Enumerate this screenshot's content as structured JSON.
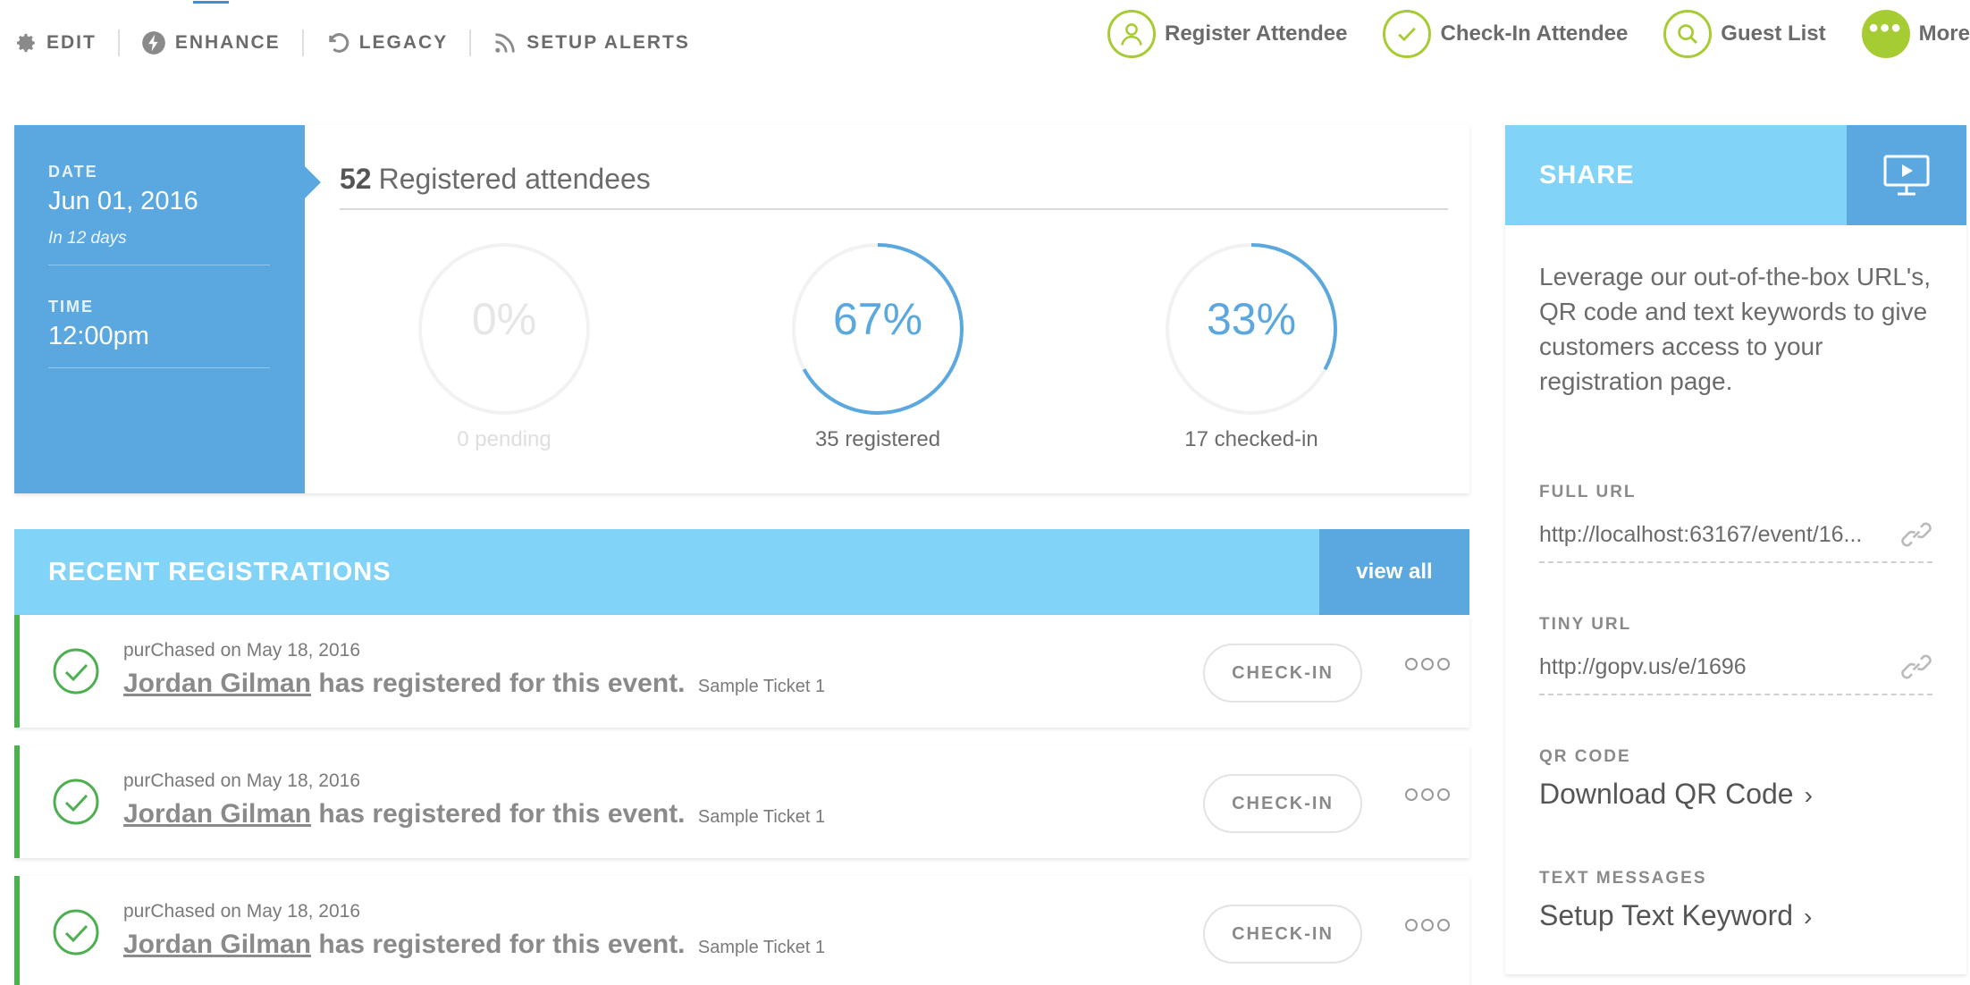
{
  "toolbar": {
    "left": [
      {
        "label": "EDIT",
        "icon": "gear-icon"
      },
      {
        "label": "ENHANCE",
        "icon": "bolt-icon"
      },
      {
        "label": "LEGACY",
        "icon": "undo-icon"
      },
      {
        "label": "SETUP ALERTS",
        "icon": "rss-icon"
      }
    ],
    "right": [
      {
        "label": "Register Attendee",
        "icon": "user-icon"
      },
      {
        "label": "Check-In Attendee",
        "icon": "check-icon"
      },
      {
        "label": "Guest List",
        "icon": "search-icon"
      },
      {
        "label": "More",
        "icon": "more-icon"
      }
    ]
  },
  "event": {
    "date_label": "DATE",
    "date": "Jun 01, 2016",
    "date_relative": "In 12 days",
    "time_label": "TIME",
    "time": "12:00pm"
  },
  "stats": {
    "total": "52",
    "total_label": "Registered attendees",
    "gauges": [
      {
        "percent_text": "0%",
        "value": 0,
        "caption": "0 pending",
        "muted": true
      },
      {
        "percent_text": "67%",
        "value": 0.67,
        "caption": "35 registered",
        "muted": false
      },
      {
        "percent_text": "33%",
        "value": 0.33,
        "caption": "17 checked-in",
        "muted": false
      }
    ]
  },
  "recent": {
    "title": "RECENT REGISTRATIONS",
    "view_all": "view all",
    "rows": [
      {
        "meta": "purChased on May 18, 2016",
        "name": "Jordan Gilman",
        "text": "has registered for this event.",
        "ticket": "Sample Ticket 1",
        "button": "CHECK-IN"
      },
      {
        "meta": "purChased on May 18, 2016",
        "name": "Jordan Gilman",
        "text": "has registered for this event.",
        "ticket": "Sample Ticket 1",
        "button": "CHECK-IN"
      },
      {
        "meta": "purChased on May 18, 2016",
        "name": "Jordan Gilman",
        "text": "has registered for this event.",
        "ticket": "Sample Ticket 1",
        "button": "CHECK-IN"
      }
    ]
  },
  "share": {
    "title": "SHARE",
    "description": "Leverage our out-of-the-box URL's, QR code and text keywords to give customers access to your registration page.",
    "full_url_label": "FULL URL",
    "full_url": "http://localhost:63167/event/16...",
    "tiny_url_label": "TINY URL",
    "tiny_url": "http://gopv.us/e/1696",
    "qr_label": "QR CODE",
    "qr_link": "Download QR Code",
    "text_label": "TEXT MESSAGES",
    "text_link": "Setup Text Keyword"
  },
  "colors": {
    "accent_green": "#a6cc33",
    "blue": "#5aa8df",
    "light_blue": "#82d3f8",
    "success_green": "#4caf50"
  }
}
